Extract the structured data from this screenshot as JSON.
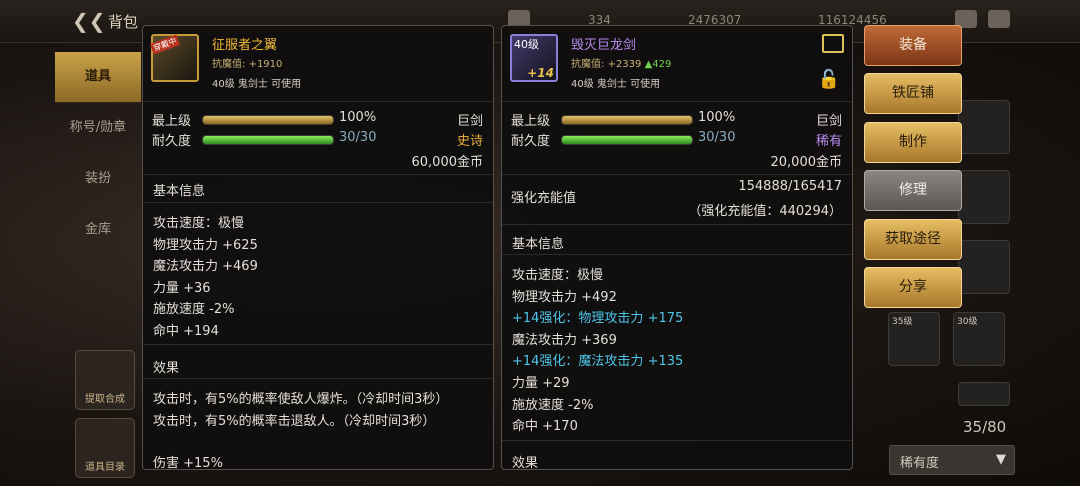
{
  "topbar": {
    "title": "背包",
    "stats": [
      "334",
      "2476307",
      "116124456"
    ]
  },
  "sidebar": {
    "tabs": [
      "道具",
      "称号/勋章",
      "装扮",
      "金库"
    ],
    "buttons": [
      "提取合成",
      "道具目录"
    ]
  },
  "grid": {
    "slot_levels": [
      "35级",
      "30级",
      "30级"
    ],
    "count": "35/80",
    "sort_label": "稀有度"
  },
  "left_item": {
    "badge": "穿戴中",
    "name": "征服者之翼",
    "anti_magic_label": "抗魔值:",
    "anti_magic_value": "+1910",
    "requirement": "40级 鬼剑士 可使用",
    "grade_label": "最上级",
    "grade_pct": "100%",
    "grade_fill": 1.0,
    "weapon_type": "巨剑",
    "durability_label": "耐久度",
    "durability": "30/30",
    "durability_fill": 1.0,
    "rarity": "史诗",
    "price": "60,000金币",
    "basic_title": "基本信息",
    "stats": [
      "攻击速度：极慢",
      "物理攻击力 +625",
      "魔法攻击力 +469",
      "力量 +36",
      "施放速度 -2%",
      "命中 +194"
    ],
    "effect_title": "效果",
    "effects": [
      "攻击时，有5%的概率使敌人爆炸。（冷却时间3秒）",
      "攻击时，有5%的概率击退敌人。（冷却时间3秒）",
      "伤害 +15%"
    ]
  },
  "right_item": {
    "level": "40级",
    "enhance": "+14",
    "name": "毁灭巨龙剑",
    "anti_magic_label": "抗魔值:",
    "anti_magic_value": "+2339",
    "anti_magic_up": "▲429",
    "requirement": "40级 鬼剑士 可使用",
    "grade_label": "最上级",
    "grade_pct": "100%",
    "grade_fill": 1.0,
    "weapon_type": "巨剑",
    "durability_label": "耐久度",
    "durability": "30/30",
    "durability_fill": 1.0,
    "rarity": "稀有",
    "price": "20,000金币",
    "charge_label": "强化充能值",
    "charge_value": "154888/165417",
    "charge_note": "（强化充能值：440294）",
    "basic_title": "基本信息",
    "stats": [
      "攻击速度：极慢",
      "物理攻击力 +492",
      "+14强化：物理攻击力 +175",
      "魔法攻击力 +369",
      "+14强化：魔法攻击力 +135",
      "力量 +29",
      "施放速度 -2%",
      "命中 +170"
    ],
    "effect_title": "效果"
  },
  "actions": [
    "装备",
    "铁匠铺",
    "制作",
    "修理",
    "获取途径",
    "分享"
  ]
}
